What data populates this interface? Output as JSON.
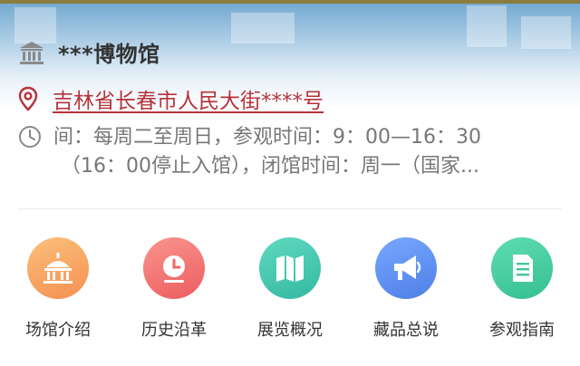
{
  "museum": {
    "name": "***博物馆",
    "address": "吉林省长春市人民大街****号",
    "hours_line1": "间：每周二至周日，参观时间：9：00—16：30",
    "hours_line2": "（16：00停止入馆），闭馆时间：周一（国家..."
  },
  "nav": {
    "items": [
      {
        "label": "场馆介绍",
        "icon": "temple-icon",
        "color": "#f7a35c"
      },
      {
        "label": "历史沿革",
        "icon": "clock-icon",
        "color": "#f0736e"
      },
      {
        "label": "展览概况",
        "icon": "map-icon",
        "color": "#4ecbb0"
      },
      {
        "label": "藏品总说",
        "icon": "megaphone-icon",
        "color": "#5b8ff0"
      },
      {
        "label": "参观指南",
        "icon": "document-icon",
        "color": "#47cfa1"
      }
    ]
  },
  "colors": {
    "address": "#b5333a",
    "secondary_text": "#777777"
  }
}
